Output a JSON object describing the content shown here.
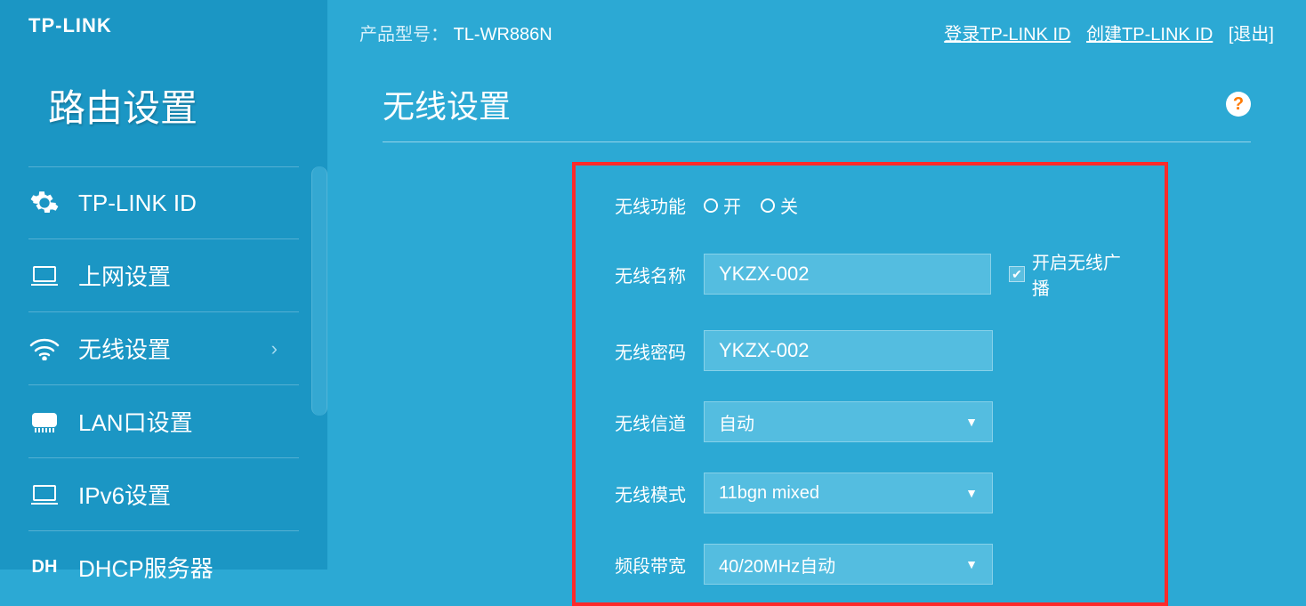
{
  "logo": "TP-LINK",
  "page_title": "路由设置",
  "sidebar": {
    "items": [
      {
        "label": "TP-LINK ID",
        "icon": "gear-icon"
      },
      {
        "label": "上网设置",
        "icon": "laptop-icon"
      },
      {
        "label": "无线设置",
        "icon": "wifi-icon",
        "active": true
      },
      {
        "label": "LAN口设置",
        "icon": "lan-icon"
      },
      {
        "label": "IPv6设置",
        "icon": "laptop-icon"
      },
      {
        "label": "DHCP服务器",
        "icon": "dh-icon"
      }
    ]
  },
  "topbar": {
    "product_label": "产品型号：",
    "product_model": "TL-WR886N",
    "login_link": "登录TP-LINK ID",
    "create_link": "创建TP-LINK ID",
    "logout_link": "[退出]"
  },
  "main": {
    "title": "无线设置",
    "help": "?",
    "wireless_func_label": "无线功能",
    "radio_on": "开",
    "radio_off": "关",
    "ssid_label": "无线名称",
    "ssid_value": "YKZX-002",
    "broadcast_label": "开启无线广播",
    "password_label": "无线密码",
    "password_value": "YKZX-002",
    "channel_label": "无线信道",
    "channel_value": "自动",
    "mode_label": "无线模式",
    "mode_value": "11bgn mixed",
    "bandwidth_label": "频段带宽",
    "bandwidth_value": "40/20MHz自动"
  }
}
